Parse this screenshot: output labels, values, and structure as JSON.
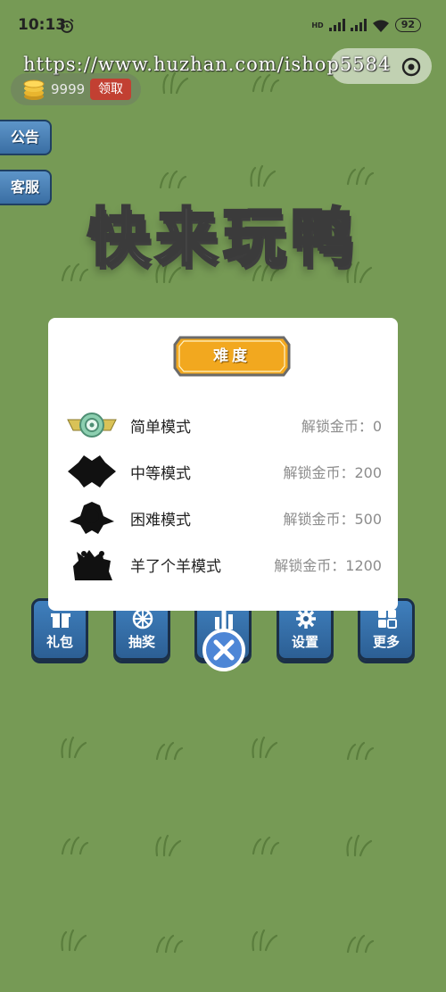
{
  "status_bar": {
    "time": "10:13",
    "network": "HD",
    "battery": "92"
  },
  "watermark": "https://www.huzhan.com/ishop5584",
  "coins": {
    "amount": "9999",
    "claim_label": "领取"
  },
  "side_buttons": {
    "notice": "公告",
    "service": "客服"
  },
  "game_title": "快来玩鸭",
  "difficulty_dialog": {
    "title": "难度",
    "modes": [
      {
        "name": "简单模式",
        "cost": "解锁金币：0"
      },
      {
        "name": "中等模式",
        "cost": "解锁金币：200"
      },
      {
        "name": "困难模式",
        "cost": "解锁金币：500"
      },
      {
        "name": "羊了个羊模式",
        "cost": "解锁金币：1200"
      }
    ]
  },
  "bottom_menu": {
    "gift": "礼包",
    "lottery": "抽奖",
    "rank": "排行",
    "settings": "设置",
    "more": "更多"
  },
  "colors": {
    "background": "#769a55",
    "menu_blue": "#3f7fbd",
    "badge_orange": "#f2a81f",
    "claim_red": "#c24032"
  }
}
